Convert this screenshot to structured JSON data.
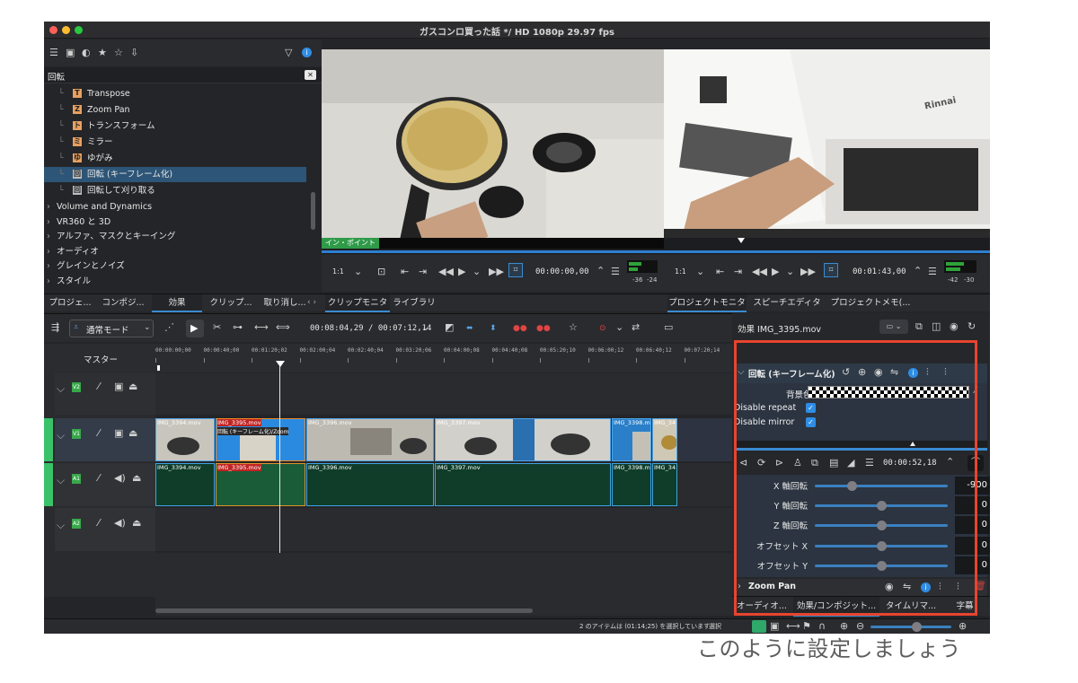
{
  "window": {
    "title": "ガスコンロ買った話 */ HD 1080p 29.97 fps"
  },
  "effects_panel": {
    "search_value": "回転",
    "items": [
      {
        "label": "Transpose",
        "icon_letter": "T",
        "icon_color": "#e8a060"
      },
      {
        "label": "Zoom Pan",
        "icon_letter": "Z",
        "icon_color": "#e8a060"
      },
      {
        "label": "トランスフォーム",
        "icon_letter": "ト",
        "icon_color": "#e8a060"
      },
      {
        "label": "ミラー",
        "icon_letter": "ミ",
        "icon_color": "#e8a060"
      },
      {
        "label": "ゆがみ",
        "icon_letter": "ゆ",
        "icon_color": "#e8a060"
      },
      {
        "label": "回転 (キーフレーム化)",
        "icon_letter": "回",
        "icon_color": "#c0c0c0"
      },
      {
        "label": "回転して刈り取る",
        "icon_letter": "回",
        "icon_color": "#c0c0c0"
      }
    ],
    "categories": [
      "Volume and Dynamics",
      "VR360 と 3D",
      "アルファ、マスクとキーイング",
      "オーディオ",
      "グレインとノイズ",
      "スタイル"
    ]
  },
  "left_tabs": [
    "プロジェ...",
    "コンポジ...",
    "効果",
    "クリップ...",
    "取り消し..."
  ],
  "clip_monitor": {
    "in_point_label": "イン・ポイント",
    "zoom": "1:1",
    "timecode": "00:00:00,00",
    "meter_left": "-36",
    "meter_right": "-24",
    "tabs": [
      "クリップモニタ",
      "ライブラリ"
    ]
  },
  "project_monitor": {
    "zoom": "1:1",
    "timecode": "00:01:43,00",
    "meter_left": "-42",
    "meter_right": "-30",
    "tabs": [
      "プロジェクトモニタ",
      "スピーチエディタ",
      "プロジェクトメモ(..."
    ],
    "brand_text": "Rinnai"
  },
  "timeline_toolbar": {
    "mode": "通常モード",
    "timecode": "00:08:04,29 / 00:07:12,14"
  },
  "timeline": {
    "master_label": "マスター",
    "ruler_ticks": [
      "00:00:00;00",
      "00:00:40;00",
      "00:01:20;02",
      "00:02:00;04",
      "00:02:40;04",
      "00:03:20;06",
      "00:04:00;08",
      "00:04:40;08",
      "00:05:20;10",
      "00:06:00;12",
      "00:06:40;12",
      "00:07:20;14"
    ],
    "tracks": [
      "V2",
      "V1",
      "A1",
      "A2"
    ],
    "video_clips": [
      "IMG_3394.mov",
      "IMG_3395.mov",
      "IMG_3396.mov",
      "IMG_3397.mov",
      "IMG_3398.mov",
      "IMG_34"
    ],
    "effect_badge": "回転 (キーフレーム化)/Zoom",
    "audio_clips": [
      "IMG_3394.mov",
      "IMG_3395.mov",
      "IMG_3396.mov",
      "IMG_3397.mov",
      "IMG_3398.m",
      "IMG_34"
    ]
  },
  "effect_stack": {
    "title": "効果 IMG_3395.mov",
    "effect_name": "回転 (キーフレーム化)",
    "bg_label": "背景色",
    "disable_repeat": "Disable repeat",
    "disable_mirror": "Disable mirror",
    "keyframe_time": "00:00:52,18",
    "params": [
      {
        "label": "X 軸回転",
        "value": "-900",
        "level": 0.28
      },
      {
        "label": "Y 軸回転",
        "value": "0",
        "level": 0.5
      },
      {
        "label": "Z 軸回転",
        "value": "0",
        "level": 0.5
      },
      {
        "label": "オフセット X",
        "value": "0",
        "level": 0.5
      },
      {
        "label": "オフセット Y",
        "value": "0",
        "level": 0.5
      }
    ],
    "second_effect": "Zoom Pan",
    "bottom_tabs": [
      "オーディオ...",
      "効果/コンポジット...",
      "タイムリマ...",
      "字幕"
    ]
  },
  "status": {
    "selection": "2 のアイテムは (01:14;25) を選択しています",
    "mode": "選択"
  },
  "caption": "このように設定しましょう"
}
